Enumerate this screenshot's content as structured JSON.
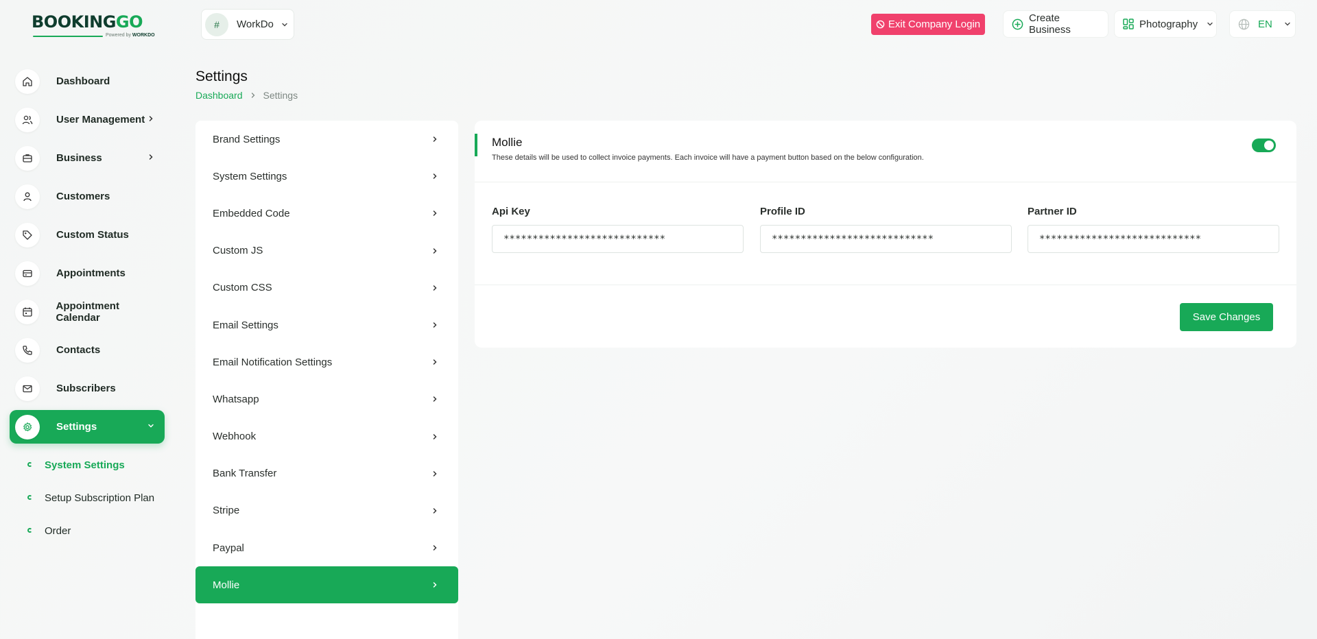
{
  "logo": {
    "text_main": "BOOKING",
    "text_accent": "GO",
    "powered_by": "Powered by",
    "brand": "WORKDO"
  },
  "header": {
    "company": {
      "name": "WorkDo",
      "avatar_text": "#"
    },
    "exit_label": "Exit Company Login",
    "create_business_label": "Create Business",
    "business_select": "Photography",
    "language": "EN"
  },
  "sidebar": {
    "items": [
      {
        "label": "Dashboard",
        "icon": "home-icon"
      },
      {
        "label": "User Management",
        "icon": "users-icon"
      },
      {
        "label": "Business",
        "icon": "briefcase-icon"
      },
      {
        "label": "Customers",
        "icon": "user-icon"
      },
      {
        "label": "Custom Status",
        "icon": "tag-icon"
      },
      {
        "label": "Appointments",
        "icon": "card-icon"
      },
      {
        "label": "Appointment Calendar",
        "icon": "calendar-icon"
      },
      {
        "label": "Contacts",
        "icon": "phone-icon"
      },
      {
        "label": "Subscribers",
        "icon": "mail-icon"
      },
      {
        "label": "Settings",
        "icon": "gear-icon"
      }
    ],
    "sub_items": [
      {
        "label": "System Settings"
      },
      {
        "label": "Setup Subscription Plan"
      },
      {
        "label": "Order"
      }
    ]
  },
  "page": {
    "title": "Settings",
    "breadcrumb_home": "Dashboard",
    "breadcrumb_current": "Settings"
  },
  "settings_menu": [
    "Brand Settings",
    "System Settings",
    "Embedded Code",
    "Custom JS",
    "Custom CSS",
    "Email Settings",
    "Email Notification Settings",
    "Whatsapp",
    "Webhook",
    "Bank Transfer",
    "Stripe",
    "Paypal",
    "Mollie"
  ],
  "mollie": {
    "title": "Mollie",
    "description": "These details will be used to collect invoice payments. Each invoice will have a payment button based on the below configuration.",
    "enabled": true,
    "api_key_label": "Api Key",
    "api_key_value": "****************************",
    "profile_id_label": "Profile ID",
    "profile_id_value": "****************************",
    "partner_id_label": "Partner ID",
    "partner_id_value": "****************************",
    "save_label": "Save Changes"
  },
  "colors": {
    "accent": "#18a957",
    "danger": "#f0416c"
  }
}
